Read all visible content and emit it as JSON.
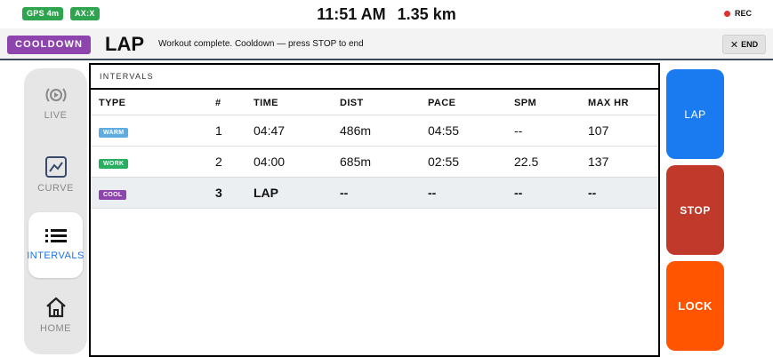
{
  "status": {
    "gps": "GPS 4m",
    "axis": "AX:X",
    "time": "11:51 AM",
    "distance": "1.35 km",
    "rec": "REC",
    "colors": {
      "pill": "#2ea44f",
      "rec_dot": "#e03131"
    }
  },
  "header": {
    "phase": "COOLDOWN",
    "title": "LAP",
    "message": "Workout complete. Cooldown — press STOP to end",
    "end_label": "END",
    "colors": {
      "phase": "#8e44ad"
    }
  },
  "nav": {
    "items": [
      {
        "label": "LIVE",
        "icon": "broadcast-icon"
      },
      {
        "label": "CURVE",
        "icon": "chart-curve-icon"
      },
      {
        "label": "INTERVALS",
        "icon": "list-icon",
        "active": true
      },
      {
        "label": "HOME",
        "icon": "home-icon"
      }
    ],
    "active_color": "#1a73e8"
  },
  "intervals": {
    "title": "INTERVALS",
    "columns": [
      "TYPE",
      "#",
      "TIME",
      "DIST",
      "PACE",
      "SPM",
      "MAX HR"
    ],
    "rows": [
      {
        "type": "WARM",
        "type_color": "#5dade2",
        "num": "1",
        "time": "04:47",
        "dist": "486m",
        "pace": "04:55",
        "spm": "--",
        "maxhr": "107"
      },
      {
        "type": "WORK",
        "type_color": "#27ae60",
        "num": "2",
        "time": "04:00",
        "dist": "685m",
        "pace": "02:55",
        "spm": "22.5",
        "maxhr": "137"
      },
      {
        "type": "COOL",
        "type_color": "#8e44ad",
        "num": "3",
        "time": "LAP",
        "dist": "--",
        "pace": "--",
        "spm": "--",
        "maxhr": "--",
        "current": true
      }
    ]
  },
  "actions": {
    "lap": "LAP",
    "stop": "STOP",
    "lock": "LOCK",
    "colors": {
      "lap": "#1a7bf0",
      "stop": "#c0392b",
      "lock": "#ff5500"
    }
  }
}
